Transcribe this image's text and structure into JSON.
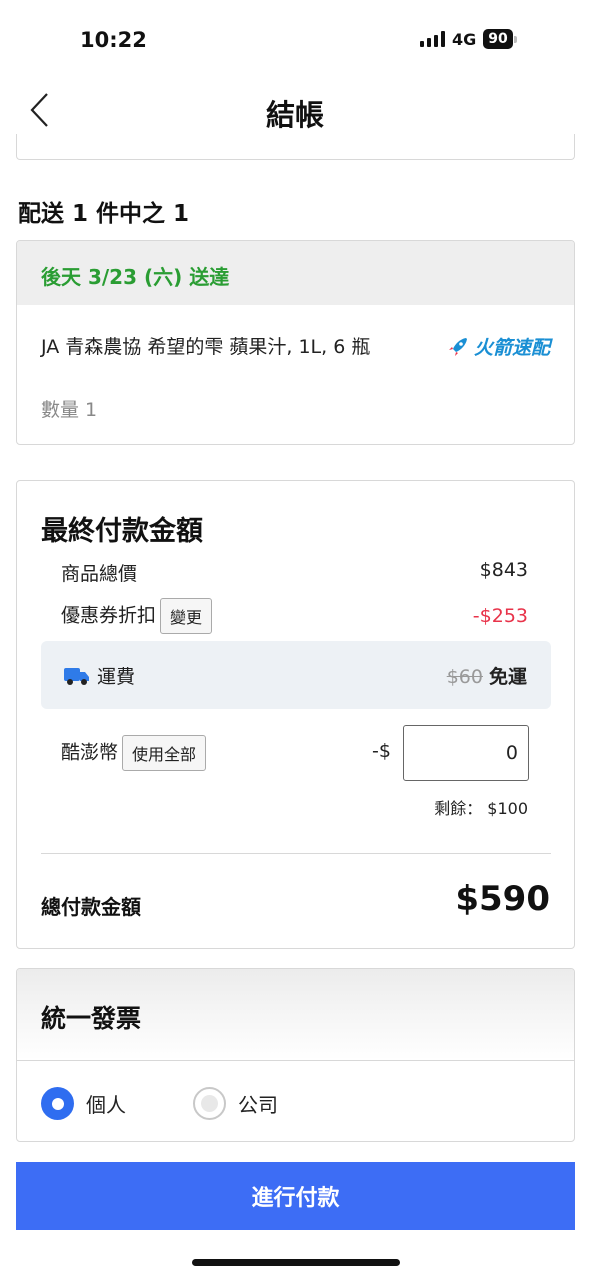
{
  "status_bar": {
    "time": "10:22",
    "network": "4G",
    "battery": "90"
  },
  "header": {
    "title": "結帳"
  },
  "shipment": {
    "title": "配送 1 件中之 1",
    "delivery_date": "後天 3/23 (六) 送達",
    "product_name": "JA 青森農協 希望的雫 蘋果汁, 1L, 6 瓶",
    "quantity": "數量 1",
    "badge": "火箭速配",
    "badge_color": "#1a8fd4"
  },
  "payment": {
    "title": "最終付款金額",
    "subtotal_label": "商品總價",
    "subtotal_value": "$843",
    "coupon_label": "優惠券折扣",
    "coupon_change": "變更",
    "coupon_value": "-$253",
    "shipping_label": "運費",
    "shipping_original": "$60",
    "shipping_value": "免運",
    "coins_label": "酷澎幣",
    "coins_use_all": "使用全部",
    "coins_prefix": "-$",
    "coins_input": "0",
    "coins_remaining": "剩餘： $100",
    "total_label": "總付款金額",
    "total_value": "$590"
  },
  "invoice": {
    "title": "統一發票",
    "options": [
      {
        "label": "個人",
        "selected": true
      },
      {
        "label": "公司",
        "selected": false
      }
    ]
  },
  "checkout_button": "進行付款",
  "colors": {
    "accent": "#3d6df5",
    "green": "#2a9d33",
    "red": "#e8334a"
  }
}
